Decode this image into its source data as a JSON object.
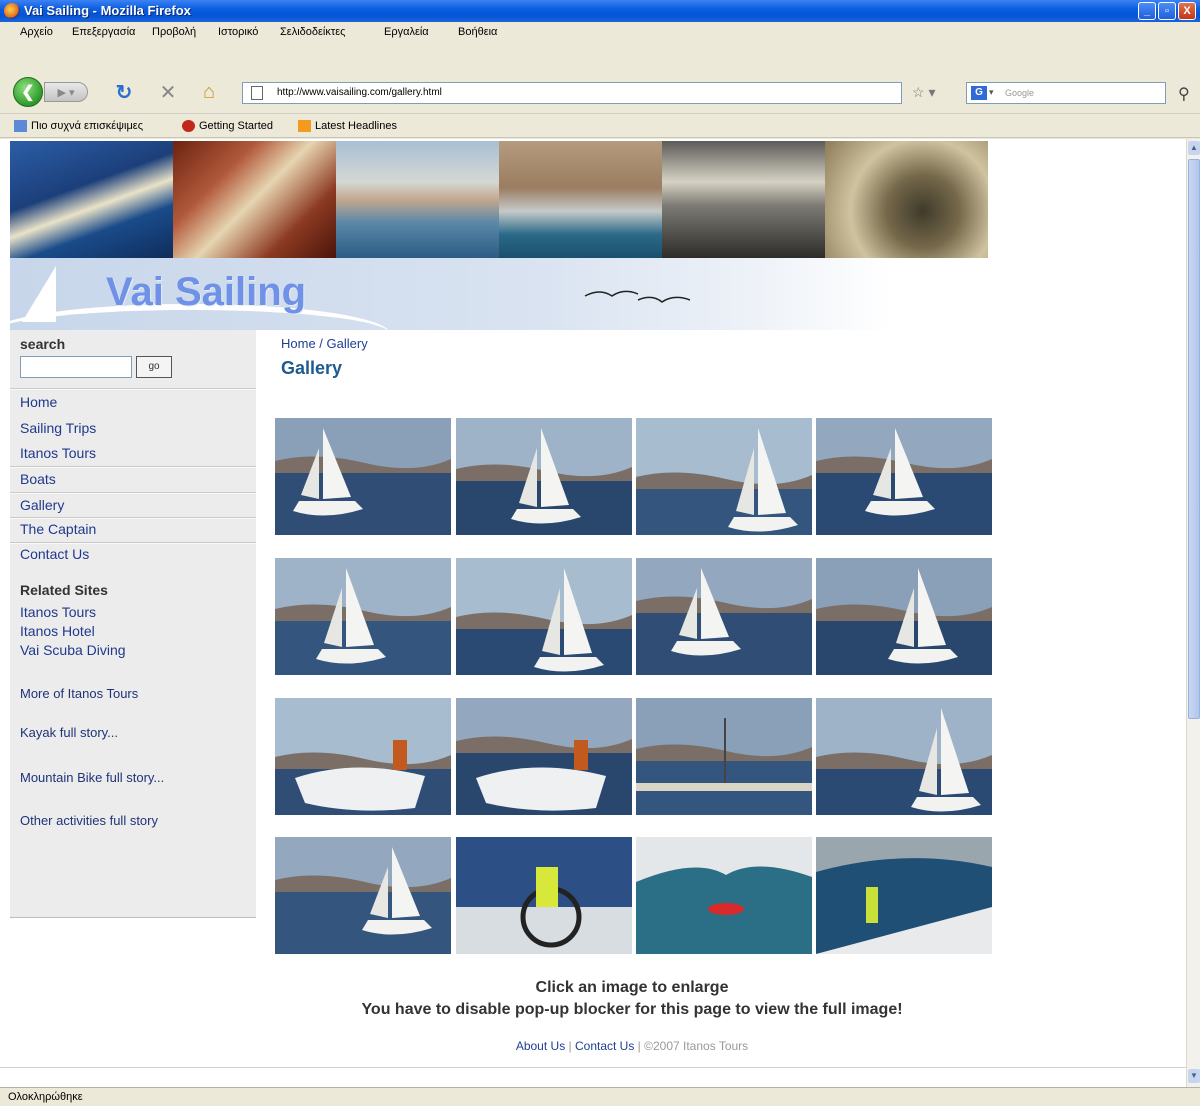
{
  "window": {
    "title": "Vai Sailing - Mozilla Firefox",
    "minimize": "_",
    "maximize": "▫",
    "close": "X"
  },
  "menu": [
    "Αρχείο",
    "Επεξεργασία",
    "Προβολή",
    "Ιστορικό",
    "Σελιδοδείκτες",
    "Εργαλεία",
    "Βοήθεια"
  ],
  "nav": {
    "url": "http://www.vaisailing.com/gallery.html",
    "search_placeholder": "Google"
  },
  "bookmarks": [
    "Πιο συχνά επισκέψιμες",
    "Getting Started",
    "Latest Headlines"
  ],
  "site": {
    "logo": "Vai Sailing"
  },
  "sidebar": {
    "search_label": "search",
    "go_label": "go",
    "nav": [
      "Home",
      "Sailing Trips",
      "Itanos Tours",
      "Boats",
      "Gallery",
      "The Captain",
      "Contact Us"
    ],
    "related_heading": "Related Sites",
    "related": [
      "Itanos Tours",
      "Itanos Hotel",
      "Vai Scuba Diving"
    ],
    "stories": [
      "More of Itanos Tours",
      "Kayak full story...",
      "Mountain Bike full story...",
      "Other activities full story"
    ]
  },
  "main": {
    "breadcrumb": "Home / Gallery",
    "title": "Gallery",
    "instruction_line1": "Click an image to enlarge",
    "instruction_line2": "You have to disable pop-up blocker for this page to view the full image!",
    "footer_about": "About Us",
    "footer_sep1": " | ",
    "footer_contact": "Contact Us",
    "footer_sep2": " | ",
    "footer_copy": "©2007 Itanos Tours"
  },
  "status": {
    "text": "Ολοκληρώθηκε"
  },
  "colors": {
    "title_bar": "#0553d8",
    "link": "#20398c",
    "page_title": "#1f5a91",
    "logo": "#6f91e6",
    "sidebar_bg": "#ececec"
  }
}
